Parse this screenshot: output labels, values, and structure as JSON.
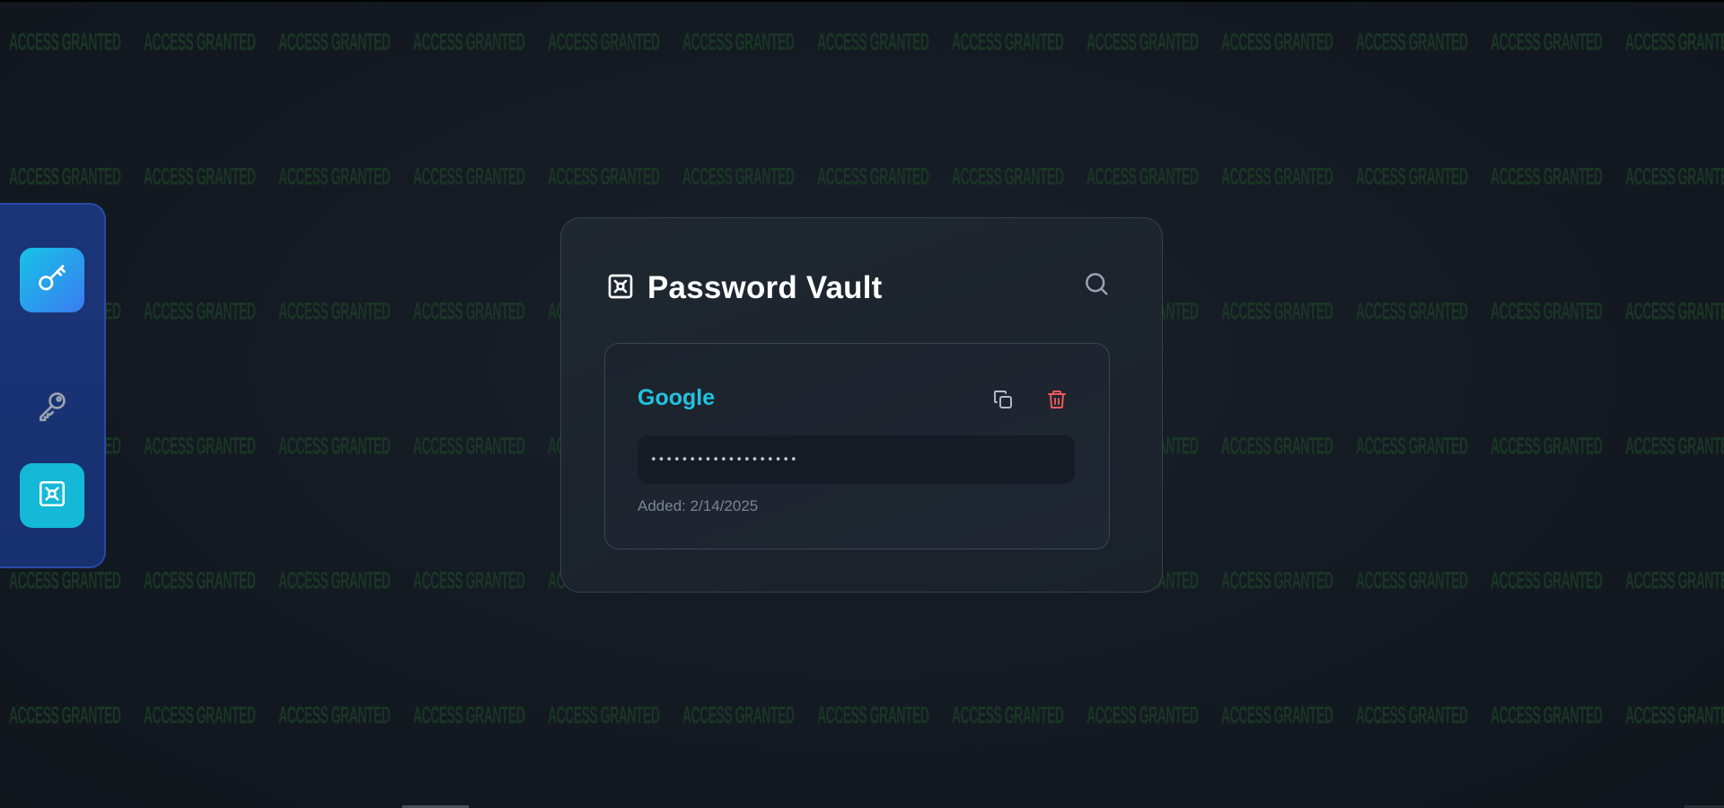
{
  "background": {
    "watermark_text": "ACCESS GRANTED",
    "watermark_color": "#1b3a26"
  },
  "sidebar": {
    "items": [
      {
        "icon": "key-round-icon",
        "label": "Password generator",
        "active": true
      },
      {
        "icon": "key-icon",
        "label": "Keys",
        "active": false
      },
      {
        "icon": "vault-icon",
        "label": "Vault",
        "active": true
      }
    ],
    "colors": {
      "background": "#1b3579",
      "accent": "#13b9d6"
    }
  },
  "vault": {
    "title": "Password Vault",
    "title_icon": "vault-icon",
    "search_icon": "search-icon",
    "entries": [
      {
        "name": "Google",
        "password_mask": "•••••••••••••••••••",
        "added_label": "Added: ",
        "added_date": "2/14/2025",
        "copy_icon": "copy-icon",
        "delete_icon": "trash-icon"
      }
    ]
  },
  "colors": {
    "site_name": "#22c3e0",
    "delete": "#f05a5a",
    "card_border": "#38414c"
  }
}
